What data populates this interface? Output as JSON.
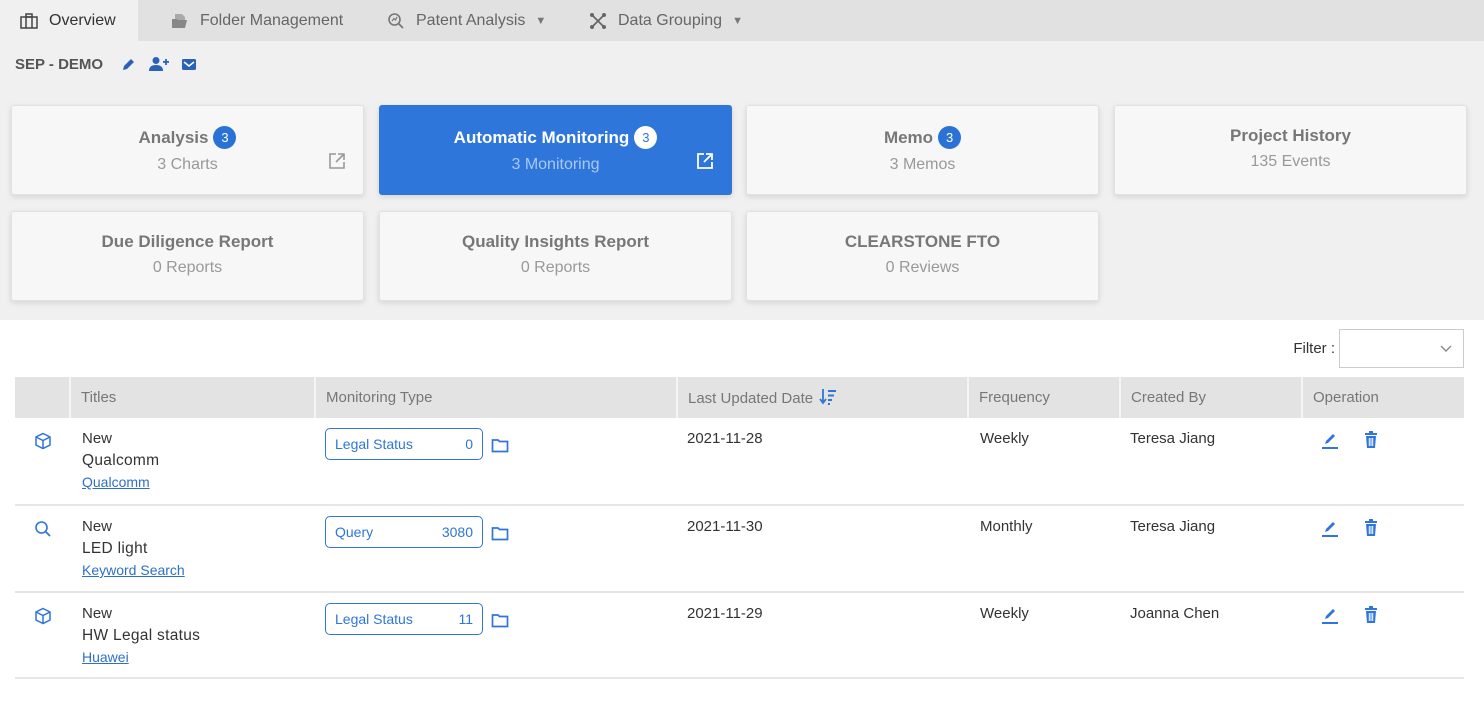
{
  "nav": {
    "tabs": [
      {
        "label": "Overview",
        "icon": "briefcase-icon",
        "active": true
      },
      {
        "label": "Folder Management",
        "icon": "folder-document-icon",
        "active": false
      },
      {
        "label": "Patent Analysis",
        "icon": "search-chart-icon",
        "active": false,
        "dropdown": true
      },
      {
        "label": "Data Grouping",
        "icon": "network-nodes-icon",
        "active": false,
        "dropdown": true
      }
    ]
  },
  "project": {
    "name": "SEP - DEMO",
    "actions": [
      "edit-icon",
      "add-user-icon",
      "mail-icon"
    ]
  },
  "cards": [
    {
      "title": "Analysis",
      "badge": "3",
      "subtitle": "3 Charts",
      "external": true,
      "active": false
    },
    {
      "title": "Automatic Monitoring",
      "badge": "3",
      "subtitle": "3 Monitoring",
      "external": true,
      "active": true
    },
    {
      "title": "Memo",
      "badge": "3",
      "subtitle": "3 Memos",
      "external": false,
      "active": false
    },
    {
      "title": "Project History",
      "subtitle": "135 Events",
      "external": false,
      "active": false
    },
    {
      "title": "Due Diligence Report",
      "subtitle": "0 Reports",
      "external": false,
      "active": false
    },
    {
      "title": "Quality Insights Report",
      "subtitle": "0 Reports",
      "external": false,
      "active": false
    },
    {
      "title": "CLEARSTONE FTO",
      "subtitle": "0 Reviews",
      "external": false,
      "active": false
    }
  ],
  "filter": {
    "label": "Filter :",
    "value": ""
  },
  "table": {
    "columns": [
      "",
      "Titles",
      "Monitoring Type",
      "Last Updated Date",
      "Frequency",
      "Created By",
      "Operation"
    ],
    "sorted_column": "Last Updated Date",
    "rows": [
      {
        "icon": "cube-icon",
        "status": "New",
        "title": "Qualcomm",
        "link": "Qualcomm",
        "type": "Legal Status",
        "count": "0",
        "date": "2021-11-28",
        "frequency": "Weekly",
        "created_by": "Teresa Jiang"
      },
      {
        "icon": "search-icon",
        "status": "New",
        "title": "LED light",
        "link": "Keyword Search",
        "type": "Query",
        "count": "3080",
        "date": "2021-11-30",
        "frequency": "Monthly",
        "created_by": "Teresa Jiang"
      },
      {
        "icon": "cube-icon",
        "status": "New",
        "title": "HW Legal status",
        "link": "Huawei",
        "type": "Legal Status",
        "count": "11",
        "date": "2021-11-29",
        "frequency": "Weekly",
        "created_by": "Joanna Chen"
      }
    ]
  },
  "colors": {
    "accent": "#2e76da",
    "badge": "#2b72d6",
    "link": "#2e6fc9"
  }
}
